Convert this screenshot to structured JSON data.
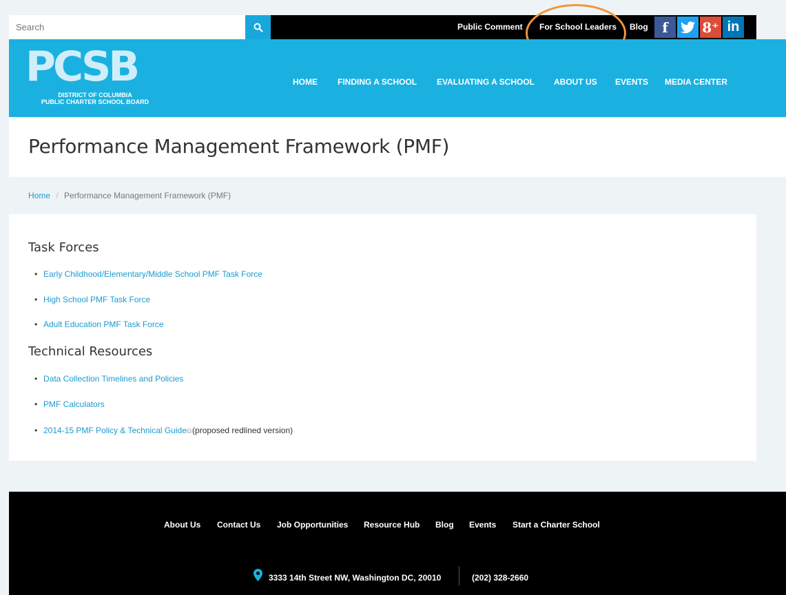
{
  "topbar": {
    "search_placeholder": "Search",
    "links": [
      "Public Comment",
      "For School Leaders",
      "Blog"
    ],
    "social": [
      {
        "icon": "facebook-icon",
        "glyph": "f",
        "color": "#3b5998"
      },
      {
        "icon": "twitter-icon",
        "glyph": "🐦",
        "color": "#1da1f2"
      },
      {
        "icon": "google-plus-icon",
        "glyph": "8⁺",
        "color": "#dd4b39"
      },
      {
        "icon": "linkedin-icon",
        "glyph": "in",
        "color": "#0077b5"
      }
    ]
  },
  "header": {
    "logo": "PCSB",
    "logo_sub_1": "DISTRICT OF COLUMBIA",
    "logo_sub_2": "PUBLIC CHARTER SCHOOL BOARD",
    "nav": [
      "HOME",
      "FINDING A SCHOOL",
      "EVALUATING A SCHOOL",
      "ABOUT US",
      "EVENTS",
      "MEDIA CENTER"
    ]
  },
  "page": {
    "title": "Performance Management Framework (PMF)",
    "breadcrumb_home": "Home",
    "breadcrumb_sep": "/",
    "breadcrumb_current": "Performance Management Framework (PMF)"
  },
  "content": {
    "task_forces_heading": "Task Forces",
    "task_forces": [
      "Early Childhood/Elementary/Middle School PMF Task Force",
      "High School PMF Task Force",
      "Adult Education PMF Task Force"
    ],
    "tech_heading": "Technical Resources",
    "tech": [
      "Data Collection Timelines and Policies",
      "PMF Calculators",
      "2014-15 PMF Policy & Technical Guide"
    ],
    "tech_note": "(proposed redlined version)"
  },
  "footer": {
    "links": [
      "About Us",
      "Contact Us",
      "Job Opportunities",
      "Resource Hub",
      "Blog",
      "Events",
      "Start a Charter School"
    ],
    "address": "3333 14th Street NW, Washington DC, 20010",
    "phone": "(202) 328-2660"
  },
  "colors": {
    "accent": "#1ab1e0",
    "link": "#1a9bd0",
    "highlight": "#f0953a"
  }
}
